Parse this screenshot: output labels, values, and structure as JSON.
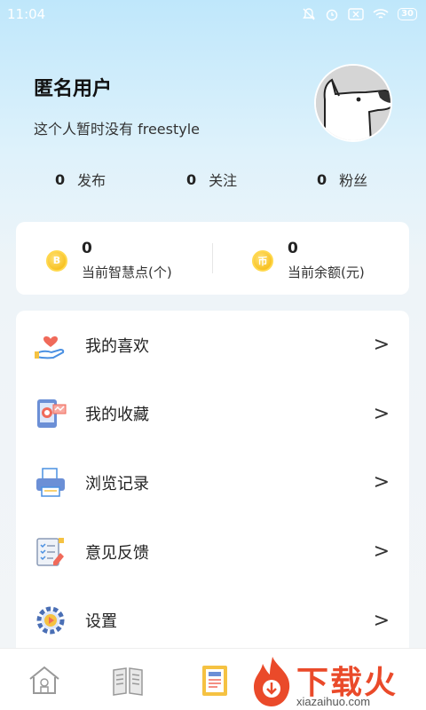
{
  "status_bar": {
    "time": "11:04",
    "battery": "30"
  },
  "profile": {
    "username": "匿名用户",
    "bio": "这个人暂时没有 freestyle"
  },
  "stats": [
    {
      "num": "0",
      "label": "发布"
    },
    {
      "num": "0",
      "label": "关注"
    },
    {
      "num": "0",
      "label": "粉丝"
    }
  ],
  "wallet": {
    "points": {
      "value": "0",
      "label": "当前智慧点(个)",
      "coin": "B"
    },
    "balance": {
      "value": "0",
      "label": "当前余额(元)",
      "coin": "币"
    }
  },
  "menu": [
    {
      "label": "我的喜欢",
      "icon": "heart-hand-icon"
    },
    {
      "label": "我的收藏",
      "icon": "tablet-target-icon"
    },
    {
      "label": "浏览记录",
      "icon": "printer-icon"
    },
    {
      "label": "意见反馈",
      "icon": "checklist-icon"
    },
    {
      "label": "设置",
      "icon": "gear-play-icon"
    }
  ],
  "chevron": ">",
  "tabbar": {
    "icons": [
      "home-icon",
      "book-icon",
      "notebook-icon"
    ]
  },
  "watermark": {
    "text": "下载火",
    "url": "xiazaihuo.com"
  },
  "colors": {
    "accent": "#ea4a2a",
    "coin": "#f5b400",
    "header_bg": "#bfe7fb"
  }
}
